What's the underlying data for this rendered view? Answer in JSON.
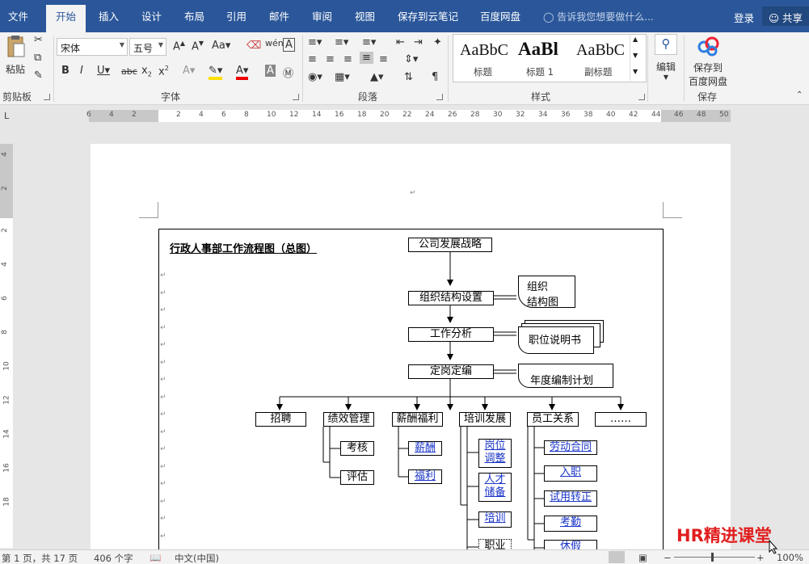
{
  "tabs": [
    "文件",
    "开始",
    "插入",
    "设计",
    "布局",
    "引用",
    "邮件",
    "审阅",
    "视图",
    "保存到云笔记",
    "百度网盘"
  ],
  "active_tab": "开始",
  "tell_me": "告诉我您想要做什么...",
  "login": "登录",
  "share": "共享",
  "ribbon": {
    "paste": "粘贴",
    "font_name": "宋体",
    "font_size": "五号",
    "style_names": [
      "标题",
      "标题 1",
      "副标题"
    ],
    "style_samples": [
      "AaBbC",
      "AaBl",
      "AaBbC"
    ],
    "edit": "编辑",
    "save_to_netdisk_line1": "保存到",
    "save_to_netdisk_line2": "百度网盘",
    "groups": {
      "clipboard": "剪贴板",
      "font": "字体",
      "paragraph": "段落",
      "styles": "样式",
      "save": "保存"
    }
  },
  "ruler_ticks": [
    "6",
    "4",
    "2",
    "2",
    "4",
    "6",
    "8",
    "10",
    "12",
    "14",
    "16",
    "18",
    "20",
    "22",
    "24",
    "26",
    "28",
    "30",
    "32",
    "34",
    "36",
    "38",
    "40",
    "42",
    "44",
    "46",
    "48",
    "50"
  ],
  "vruler_ticks": [
    "4",
    "2",
    "2",
    "4",
    "6",
    "8",
    "10",
    "12",
    "14",
    "16",
    "18"
  ],
  "document": {
    "title": "行政人事部工作流程图（总图）",
    "top": "公司发展战略",
    "org": "组织结构设置",
    "org_doc_1": "组织",
    "org_doc_2": "结构图",
    "job_analysis": "工作分析",
    "job_desc": "职位说明书",
    "staffing": "定岗定编",
    "annual_plan": "年度编制计划",
    "branches": [
      "招聘",
      "绩效管理",
      "薪酬福利",
      "培训发展",
      "员工关系",
      "……"
    ],
    "perf_sub": [
      "考核",
      "评估"
    ],
    "comp_sub": [
      "薪酬",
      "福利"
    ],
    "train_sub": [
      "岗位调整",
      "人才储备",
      "培训",
      "职业"
    ],
    "rel_sub": [
      "劳动合同",
      "入职",
      "试用转正",
      "考勤",
      "休假"
    ]
  },
  "status": {
    "page": "第 1 页，共 17 页",
    "words": "406 个字",
    "lang": "中文(中国)",
    "zoom": "100%"
  },
  "watermark": "HR精进课堂"
}
